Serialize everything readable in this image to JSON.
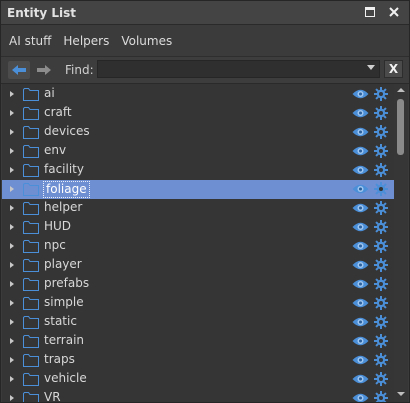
{
  "window": {
    "title": "Entity List",
    "controls": [
      "restore-icon",
      "close-icon"
    ]
  },
  "menu": [
    "AI stuff",
    "Helpers",
    "Volumes"
  ],
  "toolbar": {
    "back_icon": "arrow-left-icon",
    "forward_icon": "arrow-right-icon",
    "find_label": "Find:",
    "find_value": "",
    "clear_label": "X"
  },
  "colors": {
    "accent": "#6f8fd3",
    "icon_blue": "#4b8fd8",
    "background": "#353535"
  },
  "entities": [
    {
      "label": "ai",
      "selected": false
    },
    {
      "label": "craft",
      "selected": false
    },
    {
      "label": "devices",
      "selected": false
    },
    {
      "label": "env",
      "selected": false
    },
    {
      "label": "facility",
      "selected": false
    },
    {
      "label": "foliage",
      "selected": true
    },
    {
      "label": "helper",
      "selected": false
    },
    {
      "label": "HUD",
      "selected": false
    },
    {
      "label": "npc",
      "selected": false
    },
    {
      "label": "player",
      "selected": false
    },
    {
      "label": "prefabs",
      "selected": false
    },
    {
      "label": "simple",
      "selected": false
    },
    {
      "label": "static",
      "selected": false
    },
    {
      "label": "terrain",
      "selected": false
    },
    {
      "label": "traps",
      "selected": false
    },
    {
      "label": "vehicle",
      "selected": false
    },
    {
      "label": "VR",
      "selected": false
    }
  ]
}
